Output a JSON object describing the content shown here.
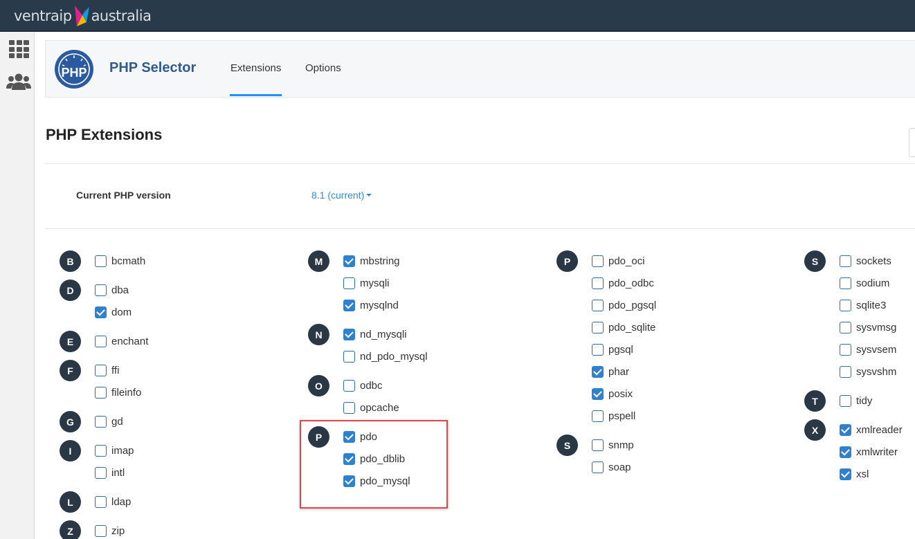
{
  "brand": {
    "name_left": "ventraip",
    "name_right": "australia"
  },
  "header": {
    "app_title": "PHP Selector",
    "tabs": [
      {
        "label": "Extensions",
        "active": true
      },
      {
        "label": "Options",
        "active": false
      }
    ]
  },
  "page": {
    "title": "PHP Extensions",
    "version_label": "Current PHP version",
    "version_value": "8.1 (current)"
  },
  "colors": {
    "accent": "#1e90ff",
    "topbar": "#293a4a",
    "letter_badge": "#2a3845",
    "highlight": "#e1444a"
  },
  "extensions": [
    {
      "letter": "B",
      "items": [
        {
          "name": "bcmath",
          "checked": false
        }
      ]
    },
    {
      "letter": "D",
      "items": [
        {
          "name": "dba",
          "checked": false
        },
        {
          "name": "dom",
          "checked": true
        }
      ]
    },
    {
      "letter": "E",
      "items": [
        {
          "name": "enchant",
          "checked": false
        }
      ]
    },
    {
      "letter": "F",
      "items": [
        {
          "name": "ffi",
          "checked": false
        },
        {
          "name": "fileinfo",
          "checked": false
        }
      ]
    },
    {
      "letter": "G",
      "items": [
        {
          "name": "gd",
          "checked": false
        }
      ]
    },
    {
      "letter": "I",
      "items": [
        {
          "name": "imap",
          "checked": false
        },
        {
          "name": "intl",
          "checked": false
        }
      ]
    },
    {
      "letter": "L",
      "items": [
        {
          "name": "ldap",
          "checked": false
        }
      ]
    },
    {
      "letter": "Z",
      "items": [
        {
          "name": "zip",
          "checked": false
        }
      ]
    },
    {
      "letter": "M",
      "items": [
        {
          "name": "mbstring",
          "checked": true
        },
        {
          "name": "mysqli",
          "checked": false
        },
        {
          "name": "mysqlnd",
          "checked": true
        }
      ]
    },
    {
      "letter": "N",
      "items": [
        {
          "name": "nd_mysqli",
          "checked": true
        },
        {
          "name": "nd_pdo_mysql",
          "checked": false
        }
      ]
    },
    {
      "letter": "O",
      "items": [
        {
          "name": "odbc",
          "checked": false
        },
        {
          "name": "opcache",
          "checked": false
        }
      ]
    },
    {
      "letter": "P",
      "items": [
        {
          "name": "pdo",
          "checked": true
        },
        {
          "name": "pdo_dblib",
          "checked": true
        },
        {
          "name": "pdo_mysql",
          "checked": true
        }
      ]
    },
    {
      "letter": "P",
      "items": [
        {
          "name": "pdo_oci",
          "checked": false
        },
        {
          "name": "pdo_odbc",
          "checked": false
        },
        {
          "name": "pdo_pgsql",
          "checked": false
        },
        {
          "name": "pdo_sqlite",
          "checked": false
        },
        {
          "name": "pgsql",
          "checked": false
        },
        {
          "name": "phar",
          "checked": true
        },
        {
          "name": "posix",
          "checked": true
        },
        {
          "name": "pspell",
          "checked": false
        }
      ]
    },
    {
      "letter": "S",
      "items": [
        {
          "name": "snmp",
          "checked": false
        },
        {
          "name": "soap",
          "checked": false
        }
      ]
    },
    {
      "letter": "S",
      "items": [
        {
          "name": "sockets",
          "checked": false
        },
        {
          "name": "sodium",
          "checked": false
        },
        {
          "name": "sqlite3",
          "checked": false
        },
        {
          "name": "sysvmsg",
          "checked": false
        },
        {
          "name": "sysvsem",
          "checked": false
        },
        {
          "name": "sysvshm",
          "checked": false
        }
      ]
    },
    {
      "letter": "T",
      "items": [
        {
          "name": "tidy",
          "checked": false
        }
      ]
    },
    {
      "letter": "X",
      "items": [
        {
          "name": "xmlreader",
          "checked": true
        },
        {
          "name": "xmlwriter",
          "checked": true
        },
        {
          "name": "xsl",
          "checked": true
        }
      ]
    }
  ]
}
